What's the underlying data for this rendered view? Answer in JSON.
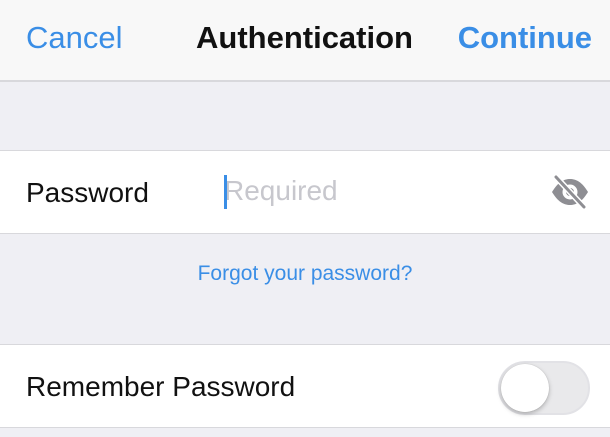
{
  "nav": {
    "cancel_label": "Cancel",
    "title": "Authentication",
    "continue_label": "Continue"
  },
  "password": {
    "label": "Password",
    "value": "",
    "placeholder": "Required",
    "visibility_icon": "eye-slash-icon"
  },
  "forgot_label": "Forgot your password?",
  "remember": {
    "label": "Remember Password",
    "enabled": false
  },
  "colors": {
    "accent": "#3a8ee6",
    "background": "#efeff4",
    "row_background": "#ffffff",
    "placeholder": "#c7c7cd"
  }
}
